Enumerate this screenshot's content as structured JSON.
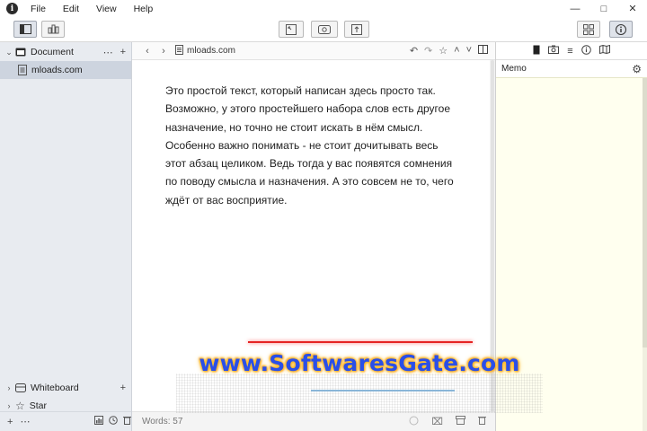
{
  "menu": {
    "items": [
      "File",
      "Edit",
      "View",
      "Help"
    ]
  },
  "sidebar": {
    "document_label": "Document",
    "document_child": "mloads.com",
    "whiteboard_label": "Whiteboard",
    "star_label": "Star"
  },
  "editor": {
    "title": "mloads.com",
    "body": "Это простой текст, который написан здесь просто так. Возможно, у этого простейшего набора слов есть другое назначение, но точно не стоит искать в нём смысл. Особенно важно понимать - не стоит дочитывать весь этот абзац целиком. Ведь тогда у вас появятся сомнения по поводу смысла и назначения. А это совсем не то, чего ждёт от вас восприятие.",
    "word_count": "Words: 57"
  },
  "right_panel": {
    "memo_label": "Memo"
  },
  "watermark": {
    "text": "www.SoftwaresGate.com"
  },
  "colors": {
    "sidebar_bg": "#e8ebf0",
    "sidebar_selected": "#cdd4df",
    "memo_bg": "#ffffef",
    "watermark_text": "#2a4fe8"
  }
}
